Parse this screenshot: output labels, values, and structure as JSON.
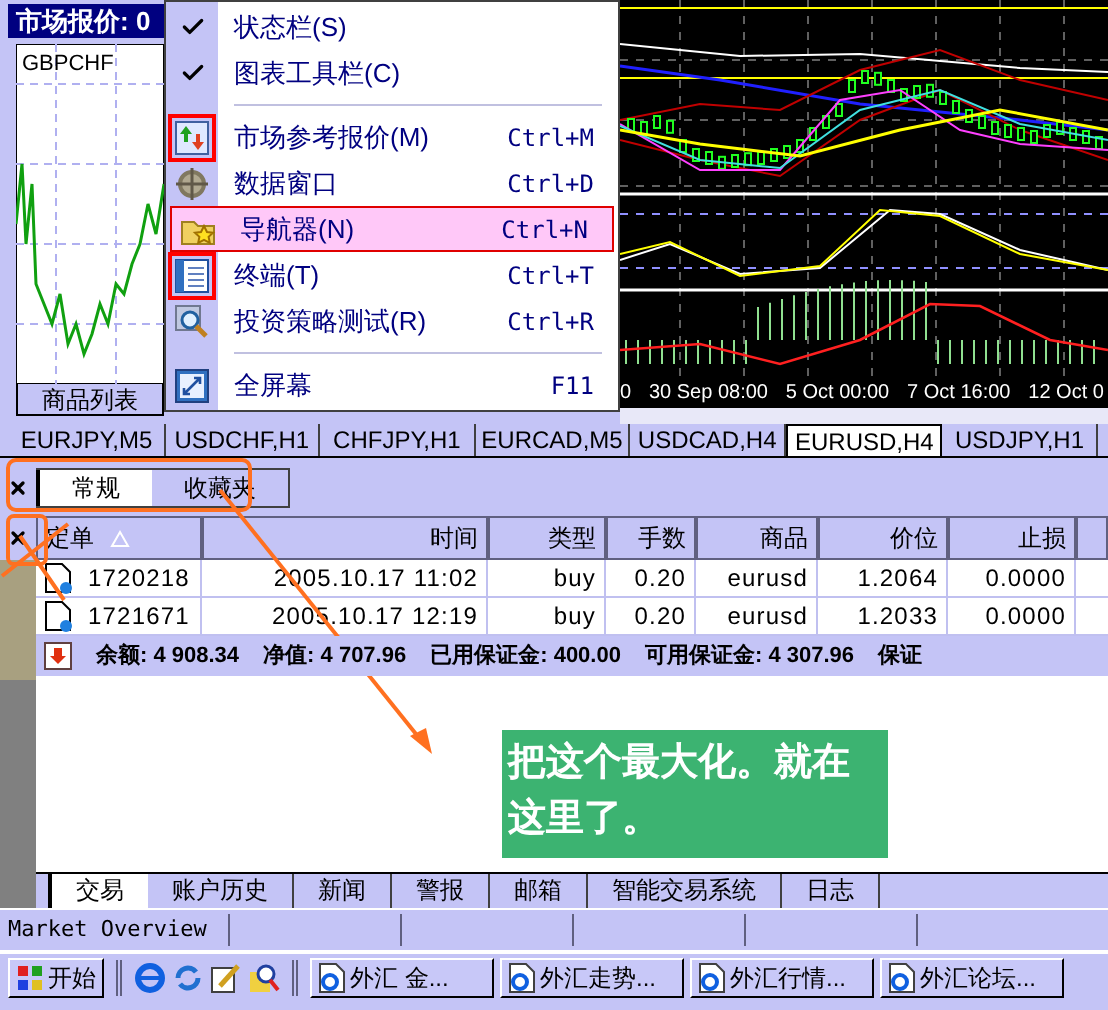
{
  "market_watch": {
    "title": "市场报价: 0",
    "symbol": "GBPCHF",
    "tabs": [
      {
        "label": "商品列表",
        "selected": true
      }
    ]
  },
  "menu": {
    "items": [
      {
        "kind": "check",
        "label": "状态栏(S)",
        "checked": true
      },
      {
        "kind": "check",
        "label": "图表工具栏(C)",
        "checked": true
      },
      {
        "kind": "separator"
      },
      {
        "kind": "command",
        "label": "市场参考报价(M)",
        "shortcut": "Ctrl+M",
        "marked": true,
        "selected": false
      },
      {
        "kind": "command",
        "label": "数据窗口",
        "shortcut": "Ctrl+D",
        "marked": false,
        "selected": false
      },
      {
        "kind": "command",
        "label": "导航器(N)",
        "shortcut": "Ctrl+N",
        "marked": false,
        "selected": true
      },
      {
        "kind": "command",
        "label": "终端(T)",
        "shortcut": "Ctrl+T",
        "marked": true,
        "selected": false
      },
      {
        "kind": "command",
        "label": "投资策略测试(R)",
        "shortcut": "Ctrl+R",
        "marked": false,
        "selected": false
      },
      {
        "kind": "separator"
      },
      {
        "kind": "command",
        "label": "全屏幕",
        "shortcut": "F11",
        "marked": false,
        "selected": false
      }
    ]
  },
  "chart": {
    "time_labels": [
      "0",
      "30 Sep 08:00",
      "5 Oct 00:00",
      "7 Oct 16:00",
      "12 Oct 0"
    ]
  },
  "chart_tabs": [
    {
      "label": "EURJPY,M5",
      "selected": false
    },
    {
      "label": "USDCHF,H1",
      "selected": false
    },
    {
      "label": "CHFJPY,H1",
      "selected": false
    },
    {
      "label": "EURCAD,M5",
      "selected": false
    },
    {
      "label": "USDCAD,H4",
      "selected": false
    },
    {
      "label": "EURUSD,H4",
      "selected": true
    },
    {
      "label": "USDJPY,H1",
      "selected": false
    }
  ],
  "navigator": {
    "tabs": [
      {
        "label": "常规",
        "selected": true
      },
      {
        "label": "收藏夹",
        "selected": false
      }
    ]
  },
  "terminal": {
    "columns": [
      {
        "label": "定单",
        "sorted": true
      },
      {
        "label": "时间",
        "sorted": false
      },
      {
        "label": "类型",
        "sorted": false
      },
      {
        "label": "手数",
        "sorted": false
      },
      {
        "label": "商品",
        "sorted": false
      },
      {
        "label": "价位",
        "sorted": false
      },
      {
        "label": "止损",
        "sorted": false
      }
    ],
    "rows": [
      [
        "1720218",
        "2005.10.17 11:02",
        "buy",
        "0.20",
        "eurusd",
        "1.2064",
        "0.0000"
      ],
      [
        "1721671",
        "2005.10.17 12:19",
        "buy",
        "0.20",
        "eurusd",
        "1.2033",
        "0.0000"
      ]
    ],
    "summary": [
      {
        "label": "余额:",
        "value": "4 908.34"
      },
      {
        "label": "净值:",
        "value": "4 707.96"
      },
      {
        "label": "已用保证金:",
        "value": "400.00"
      },
      {
        "label": "可用保证金:",
        "value": "4 307.96"
      },
      {
        "label": "保证"
      }
    ],
    "tabs": [
      {
        "label": "交易",
        "selected": true
      },
      {
        "label": "账户历史",
        "selected": false
      },
      {
        "label": "新闻",
        "selected": false
      },
      {
        "label": "警报",
        "selected": false
      },
      {
        "label": "邮箱",
        "selected": false
      },
      {
        "label": "智能交易系统",
        "selected": false
      },
      {
        "label": "日志",
        "selected": false
      }
    ]
  },
  "annotation": {
    "note": "把这个最大化。就在这里了。"
  },
  "status_bar": {
    "text": "Market Overview"
  },
  "taskbar": {
    "start": "开始",
    "tasks": [
      "外汇 金...",
      "外汇走势...",
      "外汇行情...",
      "外汇论坛..."
    ]
  }
}
